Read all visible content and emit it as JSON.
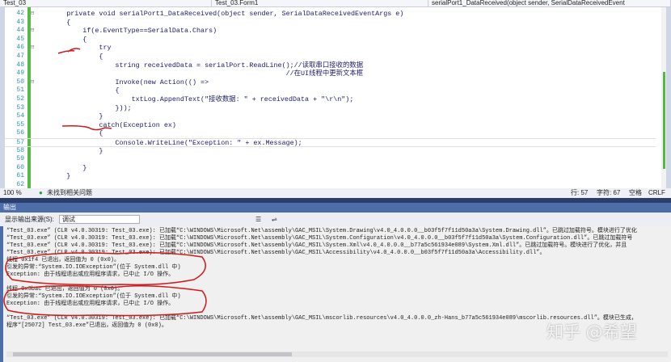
{
  "nav": {
    "project": "Test_03",
    "class": "Test_03.Form1",
    "member": "serialPort1_DataReceived(object sender, SerialDataReceivedEvent"
  },
  "code": [
    {
      "n": "42",
      "t": "        private void serialPort1_DataReceived(object sender, SerialDataReceivedEventArgs e)"
    },
    {
      "n": "43",
      "t": "        {"
    },
    {
      "n": "44",
      "t": "            if(e.EventType==SerialData.Chars)"
    },
    {
      "n": "45",
      "t": "            {"
    },
    {
      "n": "46",
      "t": "                try"
    },
    {
      "n": "47",
      "t": "                {"
    },
    {
      "n": "48",
      "t": "                    string receivedData = serialPort.ReadLine();//读取串口接收的数据"
    },
    {
      "n": "49",
      "t": "                                                              //在UI线程中更新文本框"
    },
    {
      "n": "50",
      "t": "                    Invoke(new Action(() =>"
    },
    {
      "n": "51",
      "t": "                    {"
    },
    {
      "n": "52",
      "t": "                        txtLog.AppendText(\"接收数据: \" + receivedData + \"\\r\\n\");"
    },
    {
      "n": "53",
      "t": "                    }));"
    },
    {
      "n": "54",
      "t": "                }"
    },
    {
      "n": "55",
      "t": "                catch(Exception ex)"
    },
    {
      "n": "56",
      "t": "                {"
    },
    {
      "n": "57",
      "t": "                    Console.WriteLine(\"Exception: \" + ex.Message);"
    },
    {
      "n": "58",
      "t": "                }"
    },
    {
      "n": "59",
      "t": ""
    },
    {
      "n": "60",
      "t": "            }"
    },
    {
      "n": "61",
      "t": "        }"
    },
    {
      "n": "62",
      "t": ""
    }
  ],
  "status": {
    "zoom": "100 %",
    "issues": "未找到相关问题",
    "line": "行: 57",
    "char": "字符: 67",
    "spaces": "空格",
    "eol": "CRLF"
  },
  "output": {
    "title": "输出",
    "source_label": "显示输出来源(S):",
    "source_value": "调试",
    "lines": [
      "“Test_03.exe” (CLR v4.0.30319: Test_03.exe): 已加载“C:\\WINDOWS\\Microsoft.Net\\assembly\\GAC_MSIL\\System.Drawing\\v4.0_4.0.0.0__b03f5f7f11d50a3a\\System.Drawing.dll”。已跳过加载符号。模块进行了优化",
      "“Test_03.exe” (CLR v4.0.30319: Test_03.exe): 已加载“C:\\WINDOWS\\Microsoft.Net\\assembly\\GAC_MSIL\\System.Configuration\\v4.0_4.0.0.0__b03f5f7f11d50a3a\\System.Configuration.dll”。已跳过加载符号",
      "“Test_03.exe” (CLR v4.0.30319: Test_03.exe): 已加载“C:\\WINDOWS\\Microsoft.Net\\assembly\\GAC_MSIL\\System.Xml\\v4.0_4.0.0.0__b77a5c561934e089\\System.Xml.dll”。已跳过加载符号。模块进行了优化，并且",
      "“Test_03.exe” (CLR v4.0.30319: Test_03.exe): 已加载“C:\\WINDOWS\\Microsoft.Net\\assembly\\GAC_MSIL\\Accessibility\\v4.0_4.0.0.0__b03f5f7f11d50a3a\\Accessibility.dll”。",
      "线程 0x1f4 已退出，返回值为 0 (0x0)。",
      "引发的异常:“System.IO.IOException”(位于 System.dll 中)",
      "Exception: 由于线程退出或应用程序请求，已中止 I/O 操作。",
      "",
      "线程 0x3bac 已退出，返回值为 0 (0x0)。",
      "引发的异常:“System.IO.IOException”(位于 System.dll 中)",
      "Exception: 由于线程退出或应用程序请求，已中止 I/O 操作。",
      "",
      "“Test_03.exe” (CLR v4.0.30319: Test_03.exe): 已加载“C:\\WINDOWS\\Microsoft.Net\\assembly\\GAC_MSIL\\mscorlib.resources\\v4.0_4.0.0.0_zh-Hans_b77a5c561934e089\\mscorlib.resources.dll”。模块已生成，",
      "程序“[25072] Test_03.exe”已退出，返回值为 0 (0x0)。"
    ]
  },
  "watermark": "知乎 @希望"
}
